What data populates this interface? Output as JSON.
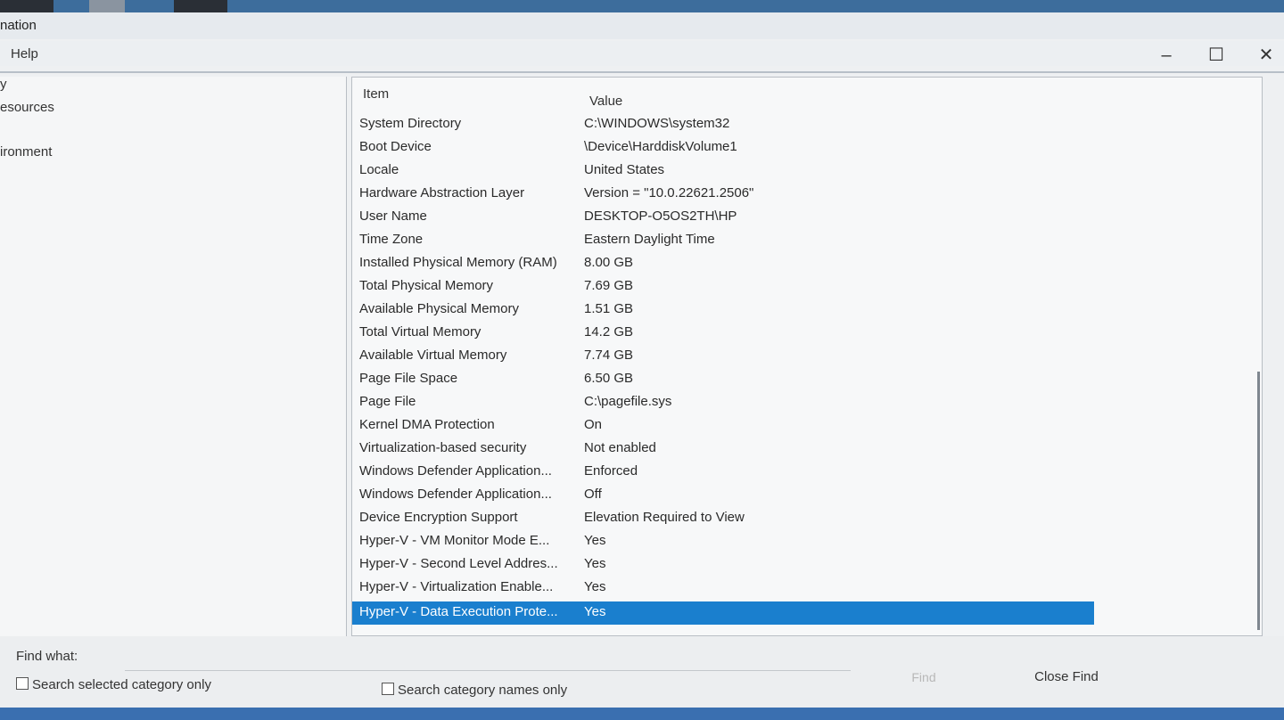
{
  "window": {
    "title": "nation"
  },
  "menu": {
    "help": "Help"
  },
  "controls": {
    "minimize": "–",
    "maximize": "☐",
    "close": "✕"
  },
  "tree": {
    "items": [
      "y",
      "esources",
      "ironment"
    ]
  },
  "list": {
    "headers": {
      "item": "Item",
      "value": "Value"
    },
    "rows": [
      {
        "item": "System Directory",
        "value": "C:\\WINDOWS\\system32"
      },
      {
        "item": "Boot Device",
        "value": "\\Device\\HarddiskVolume1"
      },
      {
        "item": "Locale",
        "value": "United States"
      },
      {
        "item": "Hardware Abstraction Layer",
        "value": "Version = \"10.0.22621.2506\""
      },
      {
        "item": "User Name",
        "value": "DESKTOP-O5OS2TH\\HP"
      },
      {
        "item": "Time Zone",
        "value": "Eastern Daylight Time"
      },
      {
        "item": "Installed Physical Memory (RAM)",
        "value": "8.00 GB"
      },
      {
        "item": "Total Physical Memory",
        "value": "7.69 GB"
      },
      {
        "item": "Available Physical Memory",
        "value": "1.51 GB"
      },
      {
        "item": "Total Virtual Memory",
        "value": "14.2 GB"
      },
      {
        "item": "Available Virtual Memory",
        "value": "7.74 GB"
      },
      {
        "item": "Page File Space",
        "value": "6.50 GB"
      },
      {
        "item": "Page File",
        "value": "C:\\pagefile.sys"
      },
      {
        "item": "Kernel DMA Protection",
        "value": "On"
      },
      {
        "item": "Virtualization-based security",
        "value": "Not enabled"
      },
      {
        "item": "Windows Defender Application...",
        "value": "Enforced"
      },
      {
        "item": "Windows Defender Application...",
        "value": "Off"
      },
      {
        "item": "Device Encryption Support",
        "value": "Elevation Required to View"
      },
      {
        "item": "Hyper-V - VM Monitor Mode E...",
        "value": "Yes"
      },
      {
        "item": "Hyper-V - Second Level Addres...",
        "value": "Yes"
      },
      {
        "item": "Hyper-V - Virtualization Enable...",
        "value": "Yes"
      },
      {
        "item": "Hyper-V - Data Execution Prote...",
        "value": "Yes"
      }
    ],
    "selected_row": "Hyper-V - Data Execution Prote..."
  },
  "find": {
    "label": "Find what:",
    "input_value": "",
    "find_button": "Find",
    "close_button": "Close Find",
    "checkbox_selected_category": "Search selected category only",
    "checkbox_category_names": "Search category names only"
  },
  "colors": {
    "selection": "#1a7fce",
    "taskbar": "#3d6d9c"
  }
}
